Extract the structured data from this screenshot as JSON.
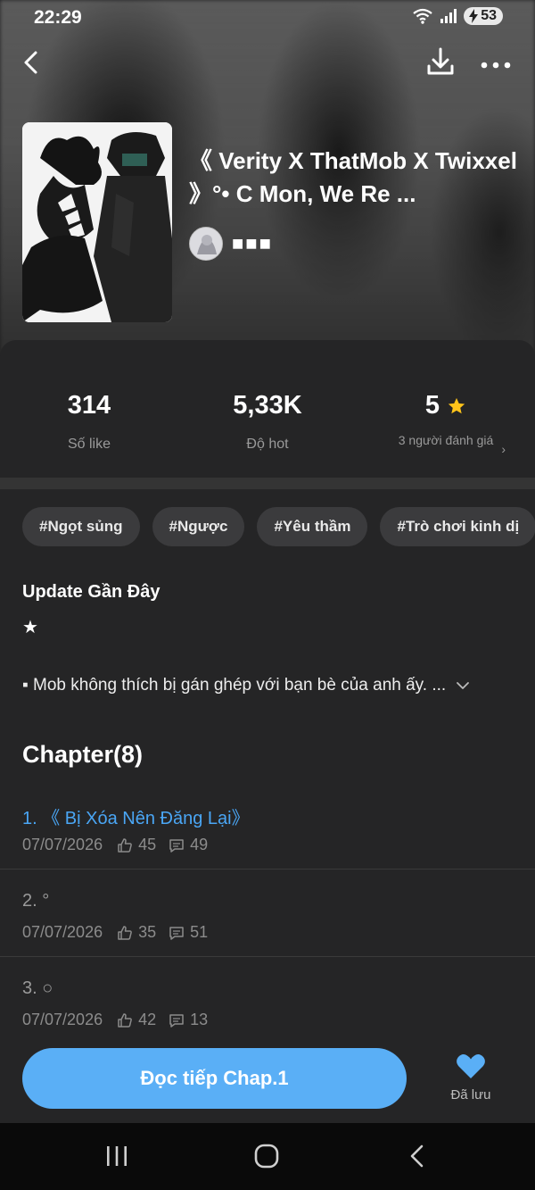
{
  "status": {
    "time": "22:29",
    "battery": "53"
  },
  "colors": {
    "accent": "#5aaff6",
    "chapter_active": "#4aa6f5",
    "star": "#ffc41a",
    "heart": "#5aaff6"
  },
  "nav": {
    "back_icon": "back-arrow-icon",
    "download_icon": "download-icon",
    "more_icon": "more-dots-icon"
  },
  "story": {
    "title": "《 Verity X ThatMob X Twixxel 》°• C Mon, We Re ...",
    "author": "■■■"
  },
  "stats": {
    "likes_value": "314",
    "likes_label": "Số like",
    "hot_value": "5,33K",
    "hot_label": "Độ hot",
    "rating_value": "5",
    "rating_label": "3 người đánh giá"
  },
  "tags": [
    "#Ngọt sủng",
    "#Ngược",
    "#Yêu thầm",
    "#Trò chơi kinh dị"
  ],
  "update": {
    "title": "Update Gần Đây",
    "star": "★",
    "synopsis": "▪ Mob không thích bị gán ghép với bạn bè của anh ấy. ..."
  },
  "chapters_title": "Chapter(8)",
  "chapters": [
    {
      "name": "1. 《 Bị Xóa Nên Đăng Lại》",
      "date": "07/07/2026",
      "likes": "45",
      "comments": "49"
    },
    {
      "name": "2. °",
      "date": "07/07/2026",
      "likes": "35",
      "comments": "51"
    },
    {
      "name": "3. ○",
      "date": "07/07/2026",
      "likes": "42",
      "comments": "13"
    }
  ],
  "bottom": {
    "read_label": "Đọc tiếp Chap.1",
    "saved_label": "Đã lưu"
  }
}
